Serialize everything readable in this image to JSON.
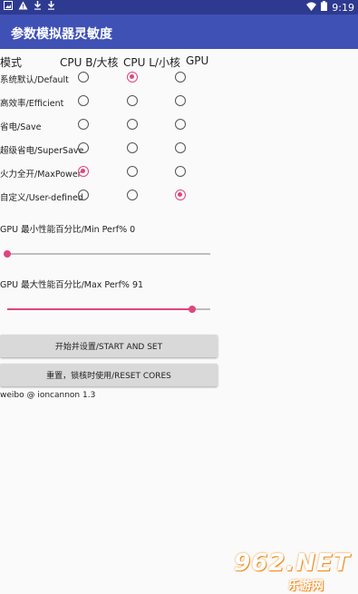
{
  "status_bar": {
    "left_icons": [
      "image-icon",
      "warning-icon",
      "download-icon",
      "download-icon"
    ],
    "time": "9:19",
    "right_icons": [
      "wifi-icon",
      "battery-icon"
    ]
  },
  "app": {
    "title": "参数模拟器灵敏度"
  },
  "table": {
    "header_mode": "模式",
    "columns": [
      "CPU B/大核",
      "CPU L/小核",
      "GPU"
    ],
    "rows": [
      {
        "label": "系统默认/Default",
        "selected_column": 1
      },
      {
        "label": "高效率/Efficient",
        "selected_column": null
      },
      {
        "label": "省电/Save",
        "selected_column": null
      },
      {
        "label": "超级省电/SuperSave",
        "selected_column": null
      },
      {
        "label": "火力全开/MaxPower",
        "selected_column": 0
      },
      {
        "label": "自定义/User-defined",
        "selected_column": 2
      }
    ]
  },
  "sliders": [
    {
      "label": "GPU 最小性能百分比/Min Perf% 0",
      "value_percent": 0
    },
    {
      "label": "GPU 最大性能百分比/Max Perf% 91",
      "value_percent": 91
    }
  ],
  "buttons": {
    "start": "开始并设置/START AND SET",
    "reset": "重置，锁核时使用/RESET CORES"
  },
  "footer": "weibo @ ioncannon 1.3",
  "watermark": {
    "number": "962.NET",
    "site": "乐游网"
  },
  "colors": {
    "status_bar": "#2e3a8f",
    "app_bar": "#3f51b5",
    "accent": "#e0457e"
  }
}
